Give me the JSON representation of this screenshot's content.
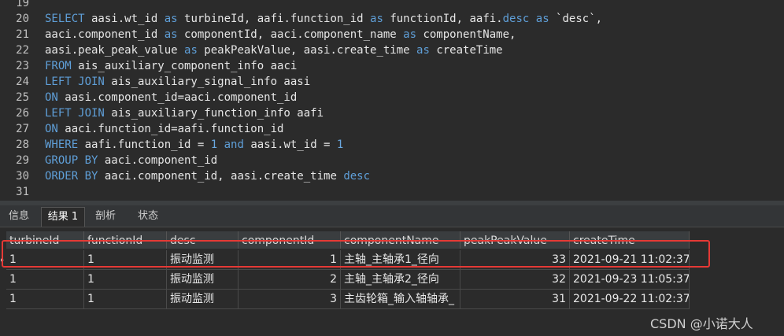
{
  "editor": {
    "lines": [
      {
        "n": "19",
        "tokens": []
      },
      {
        "n": "20",
        "tokens": [
          {
            "t": "SELECT",
            "k": "kw"
          },
          {
            "t": " aasi.wt_id "
          },
          {
            "t": "as",
            "k": "kw"
          },
          {
            "t": " turbineId, aafi.function_id "
          },
          {
            "t": "as",
            "k": "kw"
          },
          {
            "t": " functionId, aafi."
          },
          {
            "t": "desc",
            "k": "kw"
          },
          {
            "t": " "
          },
          {
            "t": "as",
            "k": "kw"
          },
          {
            "t": " `desc`,"
          }
        ]
      },
      {
        "n": "21",
        "tokens": [
          {
            "t": "aaci.component_id "
          },
          {
            "t": "as",
            "k": "kw"
          },
          {
            "t": " componentId, aaci.component_name "
          },
          {
            "t": "as",
            "k": "kw"
          },
          {
            "t": " componentName,"
          }
        ]
      },
      {
        "n": "22",
        "tokens": [
          {
            "t": "aasi.peak_peak_value "
          },
          {
            "t": "as",
            "k": "kw"
          },
          {
            "t": " peakPeakValue, aasi.create_time "
          },
          {
            "t": "as",
            "k": "kw"
          },
          {
            "t": " createTime"
          }
        ]
      },
      {
        "n": "23",
        "tokens": [
          {
            "t": "FROM",
            "k": "kw"
          },
          {
            "t": " ais_auxiliary_component_info aaci"
          }
        ]
      },
      {
        "n": "24",
        "tokens": [
          {
            "t": "LEFT JOIN",
            "k": "kw"
          },
          {
            "t": " ais_auxiliary_signal_info aasi"
          }
        ]
      },
      {
        "n": "25",
        "tokens": [
          {
            "t": "ON",
            "k": "kw"
          },
          {
            "t": " aasi.component_id=aaci.component_id"
          }
        ]
      },
      {
        "n": "26",
        "tokens": [
          {
            "t": "LEFT JOIN",
            "k": "kw"
          },
          {
            "t": " ais_auxiliary_function_info aafi"
          }
        ]
      },
      {
        "n": "27",
        "tokens": [
          {
            "t": "ON",
            "k": "kw"
          },
          {
            "t": " aaci.function_id=aafi.function_id"
          }
        ]
      },
      {
        "n": "28",
        "tokens": [
          {
            "t": "WHERE",
            "k": "kw"
          },
          {
            "t": " aafi.function_id = "
          },
          {
            "t": "1",
            "k": "num"
          },
          {
            "t": " "
          },
          {
            "t": "and",
            "k": "kw"
          },
          {
            "t": " aasi.wt_id = "
          },
          {
            "t": "1",
            "k": "num"
          }
        ]
      },
      {
        "n": "29",
        "tokens": [
          {
            "t": "GROUP BY",
            "k": "kw"
          },
          {
            "t": " aaci.component_id"
          }
        ]
      },
      {
        "n": "30",
        "tokens": [
          {
            "t": "ORDER BY",
            "k": "kw"
          },
          {
            "t": " aaci.component_id, aasi.create_time "
          },
          {
            "t": "desc",
            "k": "kw"
          }
        ]
      },
      {
        "n": "31",
        "tokens": []
      }
    ]
  },
  "tabs": [
    {
      "label": "信息",
      "active": false
    },
    {
      "label": "结果 1",
      "active": true
    },
    {
      "label": "剖析",
      "active": false
    },
    {
      "label": "状态",
      "active": false
    }
  ],
  "result": {
    "columns": [
      "turbineId",
      "functionId",
      "desc",
      "componentId",
      "componentName",
      "peakPeakValue",
      "createTime"
    ],
    "rows": [
      [
        "1",
        "1",
        "振动监测",
        "1",
        "主轴_主轴承1_径向",
        "33",
        "2021-09-21 11:02:37"
      ],
      [
        "1",
        "1",
        "振动监测",
        "2",
        "主轴_主轴承2_径向",
        "32",
        "2021-09-23 11:05:37"
      ],
      [
        "1",
        "1",
        "振动监测",
        "3",
        "主齿轮箱_输入轴轴承_",
        "31",
        "2021-09-22 11:02:37"
      ]
    ]
  },
  "watermark": "CSDN @小诺大人",
  "colors": {
    "keyword": "#5f9fd8",
    "highlight": "#e53935",
    "background": "#2b2b2b"
  }
}
